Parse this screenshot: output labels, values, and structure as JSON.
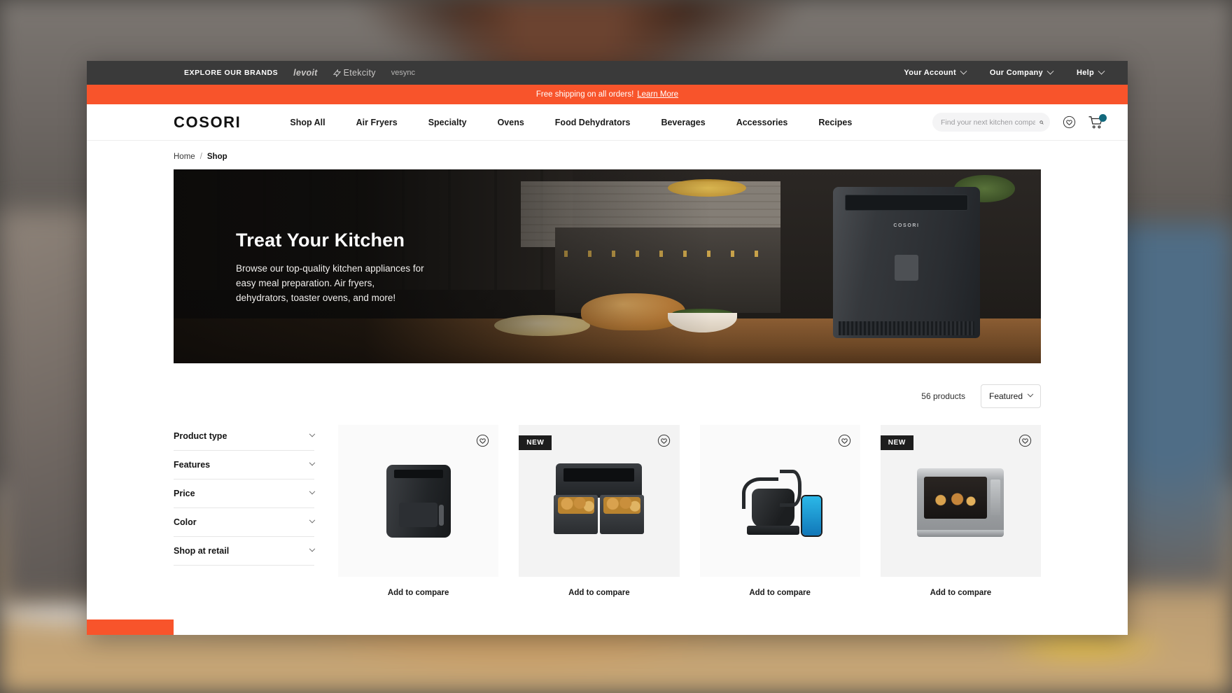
{
  "utility_bar": {
    "brands_label": "EXPLORE OUR BRANDS",
    "brands": [
      "levoit",
      "Etekcity",
      "vesync"
    ],
    "menus": [
      {
        "label": "Your Account",
        "icon": "chevron-down-icon"
      },
      {
        "label": "Our Company",
        "icon": "chevron-down-icon"
      },
      {
        "label": "Help",
        "icon": "chevron-down-icon"
      }
    ]
  },
  "promo": {
    "text": "Free shipping on all orders!",
    "link_label": "Learn More",
    "background": "#f8542b"
  },
  "nav": {
    "logo": "COSORI",
    "links": [
      "Shop All",
      "Air Fryers",
      "Specialty",
      "Ovens",
      "Food Dehydrators",
      "Beverages",
      "Accessories",
      "Recipes"
    ],
    "search": {
      "placeholder": "Find your next kitchen companion...",
      "value": ""
    },
    "wishlist_icon": "heart-circle-icon",
    "cart_icon": "cart-icon",
    "cart_badge_color": "#12697d"
  },
  "breadcrumb": {
    "home": "Home",
    "separator": "/",
    "current": "Shop"
  },
  "hero": {
    "title": "Treat Your Kitchen",
    "description": "Browse our top-quality kitchen appliances for easy meal preparation. Air fryers, dehydrators, toaster ovens, and more!"
  },
  "toolbar": {
    "product_count": "56 products",
    "sort_value": "Featured"
  },
  "filters": [
    {
      "label": "Product type",
      "icon": "chevron-down-icon"
    },
    {
      "label": "Features",
      "icon": "chevron-down-icon"
    },
    {
      "label": "Price",
      "icon": "chevron-down-icon"
    },
    {
      "label": "Color",
      "icon": "chevron-down-icon"
    },
    {
      "label": "Shop at retail",
      "icon": "chevron-down-icon"
    }
  ],
  "products": [
    {
      "badge": "",
      "compare_label": "Add to compare",
      "wishlist_icon": "heart-icon"
    },
    {
      "badge": "NEW",
      "compare_label": "Add to compare",
      "wishlist_icon": "heart-icon"
    },
    {
      "badge": "",
      "compare_label": "Add to compare",
      "wishlist_icon": "heart-icon"
    },
    {
      "badge": "NEW",
      "compare_label": "Add to compare",
      "wishlist_icon": "heart-icon"
    }
  ]
}
